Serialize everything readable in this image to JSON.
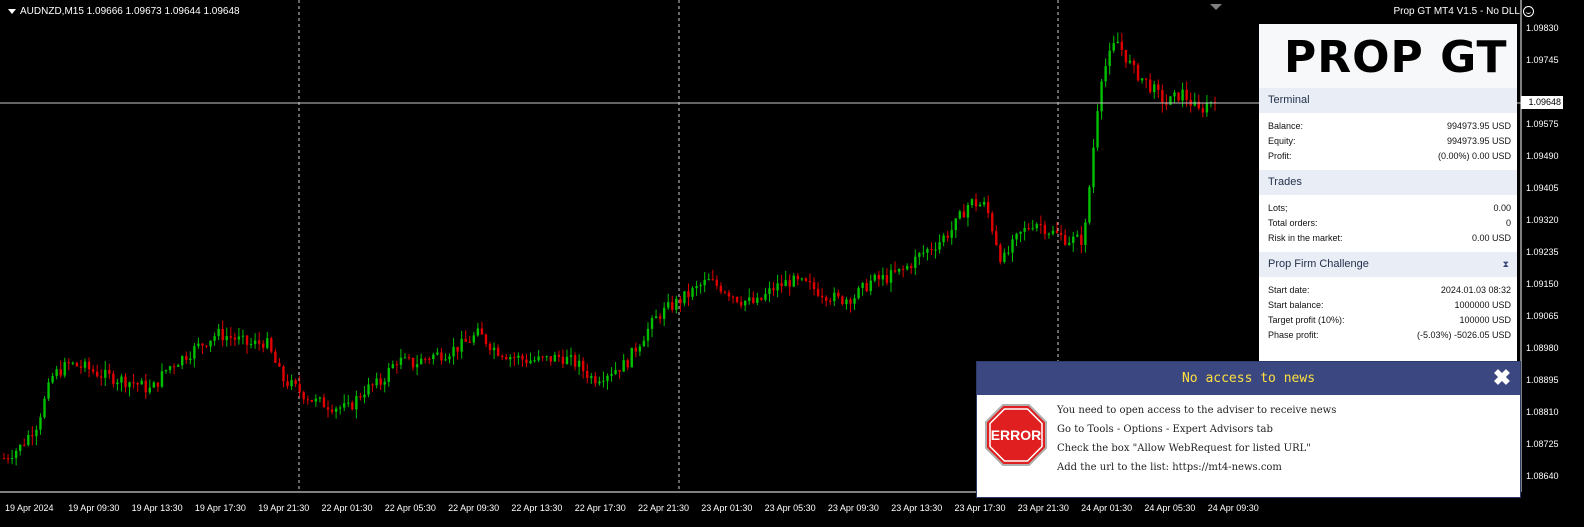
{
  "chart_header": {
    "symbol_line": "AUDNZD,M15  1.09666 1.09673 1.09644 1.09648",
    "ea_name": "Prop GT MT4 V1.5 - No DLL"
  },
  "chart_data": {
    "type": "candlestick",
    "symbol": "AUDNZD",
    "timeframe": "M15",
    "ohlc_current": {
      "open": 1.09666,
      "high": 1.09673,
      "low": 1.09644,
      "close": 1.09648
    },
    "current_price": "1.09648",
    "ylim": [
      1.086,
      1.0988
    ],
    "y_ticks": [
      "1.09830",
      "1.09745",
      "1.09575",
      "1.09490",
      "1.09405",
      "1.09320",
      "1.09235",
      "1.09150",
      "1.09065",
      "1.08980",
      "1.08895",
      "1.08810",
      "1.08725",
      "1.08640"
    ],
    "y_tick_values": [
      1.0983,
      1.09745,
      1.09575,
      1.0949,
      1.09405,
      1.0932,
      1.09235,
      1.0915,
      1.09065,
      1.0898,
      1.08895,
      1.0881,
      1.08725,
      1.0864
    ],
    "x_ticks": [
      "19 Apr 2024",
      "19 Apr 09:30",
      "19 Apr 13:30",
      "19 Apr 17:30",
      "19 Apr 21:30",
      "22 Apr 01:30",
      "22 Apr 05:30",
      "22 Apr 09:30",
      "22 Apr 13:30",
      "22 Apr 17:30",
      "22 Apr 21:30",
      "23 Apr 01:30",
      "23 Apr 05:30",
      "23 Apr 09:30",
      "23 Apr 13:30",
      "23 Apr 17:30",
      "23 Apr 21:30",
      "24 Apr 01:30",
      "24 Apr 05:30",
      "24 Apr 09:30"
    ],
    "close_path": [
      1.0869,
      1.0872,
      1.0878,
      1.0891,
      1.0894,
      1.0893,
      1.0891,
      1.089,
      1.0889,
      1.0887,
      1.0893,
      1.0896,
      1.0899,
      1.0902,
      1.0901,
      1.0899,
      1.09,
      1.089,
      1.0887,
      1.0884,
      1.0883,
      1.0882,
      1.0887,
      1.0889,
      1.0895,
      1.0894,
      1.0896,
      1.0897,
      1.0899,
      1.0902,
      1.0898,
      1.0896,
      1.0895,
      1.0895,
      1.0896,
      1.0894,
      1.089,
      1.0892,
      1.0894,
      1.0901,
      1.0907,
      1.091,
      1.0913,
      1.0916,
      1.0914,
      1.0911,
      1.091,
      1.0914,
      1.0916,
      1.0915,
      1.0913,
      1.0911,
      1.0912,
      1.0916,
      1.0917,
      1.0919,
      1.0923,
      1.0926,
      1.093,
      1.0937,
      1.0936,
      1.0921,
      1.0928,
      1.0932,
      1.0929,
      1.0927,
      1.0927,
      1.097,
      1.098,
      1.0972,
      1.0968,
      1.0963,
      1.0966,
      1.0961,
      1.0965
    ]
  },
  "panel": {
    "logo_text": "PROP GT",
    "terminal": {
      "title": "Terminal",
      "rows": [
        {
          "label": "Balance:",
          "value": "994973.95 USD"
        },
        {
          "label": "Equity:",
          "value": "994973.95 USD"
        },
        {
          "label": "Profit:",
          "value": "(0.00%) 0.00 USD"
        }
      ]
    },
    "trades": {
      "title": "Trades",
      "rows": [
        {
          "label": "Lots;",
          "value": "0.00"
        },
        {
          "label": "Total orders:",
          "value": "0"
        },
        {
          "label": "Risk in the market:",
          "value": "0.00 USD"
        }
      ]
    },
    "challenge": {
      "title": "Prop Firm Challenge",
      "icon": "⧗",
      "rows": [
        {
          "label": "Start date:",
          "value": "2024.01.03 08:32"
        },
        {
          "label": "Start balance:",
          "value": "1000000 USD"
        },
        {
          "label": "Target profit (10%):",
          "value": "100000 USD"
        },
        {
          "label": "Phase profit:",
          "value": "(-5.03%) -5026.05 USD"
        }
      ]
    }
  },
  "dialog": {
    "title": "No access to news",
    "close_glyph": "✖",
    "error_label": "ERROR",
    "lines": [
      "You need to open access to the adviser to receive news",
      "Go to Tools - Options - Expert Advisors tab",
      "Check the box \"Allow WebRequest for listed URL\"",
      "Add the url to the list: https://mt4-news.com"
    ]
  },
  "colors": {
    "bull": "#00c000",
    "bear": "#e00000",
    "panel_head": "#e8edf6",
    "dialog_head": "#3a4780",
    "dialog_title": "#ffe040"
  }
}
